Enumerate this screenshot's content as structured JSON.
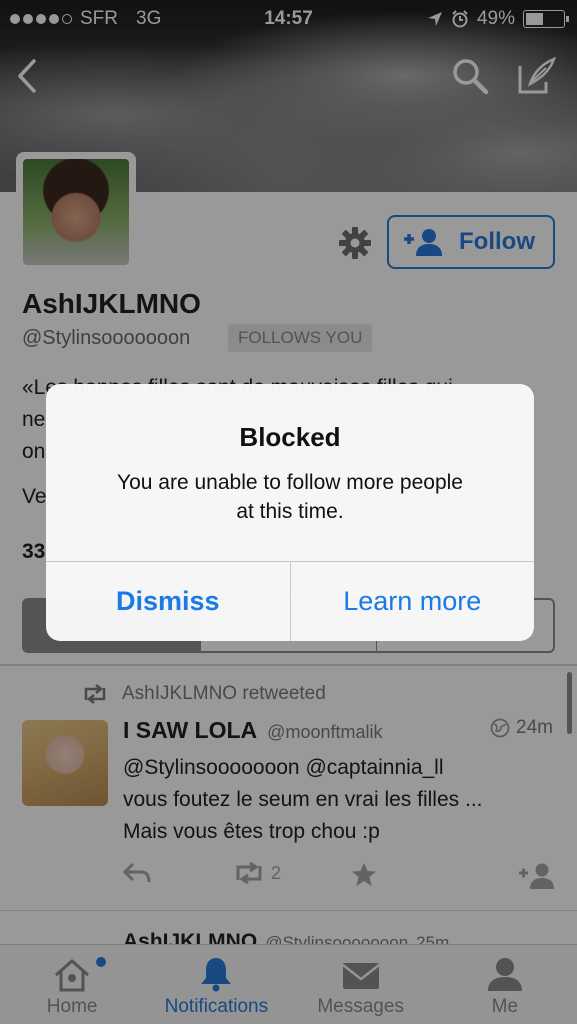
{
  "status_bar": {
    "carrier": "SFR",
    "network": "3G",
    "time": "14:57",
    "battery": "49%",
    "battery_level": 0.49
  },
  "profile": {
    "follow_label": "Follow",
    "name": "AshIJKLMNO",
    "handle": "@Stylinsooooooon",
    "follows_badge": "FOLLOWS YOU",
    "bio_line1": "«Les bonnes filles sont de mauvaises filles qui",
    "bio_line2": "ne",
    "bio_line3": "on",
    "web_prefix": "Ve",
    "count_prefix": "33"
  },
  "timeline": {
    "retweet_label": "AshIJKLMNO retweeted",
    "tweet": {
      "name": "I SAW LOLA",
      "handle": "@moonftmalik",
      "time": "24m",
      "line1": "@Stylinsooooooon @captainnia_ll",
      "line2": "vous foutez le seum en vrai les filles ...",
      "line3": "Mais vous êtes trop chou :p",
      "retweet_count": "2"
    },
    "tweet2": {
      "name": "AshIJKLMNO",
      "handle": "@Stylinsooooooon",
      "time": "25m"
    }
  },
  "tabs": [
    {
      "label": "Home",
      "icon": "home-icon"
    },
    {
      "label": "Notifications",
      "icon": "bell-icon"
    },
    {
      "label": "Messages",
      "icon": "envelope-icon"
    },
    {
      "label": "Me",
      "icon": "person-icon"
    }
  ],
  "alert": {
    "title": "Blocked",
    "message_line1": "You are unable to follow more people",
    "message_line2": "at this time.",
    "dismiss_label": "Dismiss",
    "learn_more_label": "Learn more"
  },
  "colors": {
    "accent": "#2b7bd9",
    "alert_button": "#1a7ae6"
  }
}
